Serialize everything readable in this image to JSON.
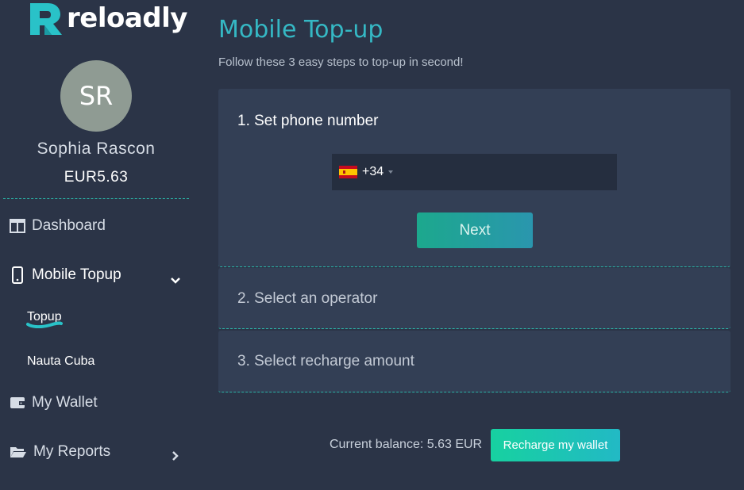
{
  "brand": {
    "name": "reloadly",
    "accent": "#35b8c4"
  },
  "user": {
    "initials": "SR",
    "name": "Sophia Rascon",
    "balance": "EUR5.63"
  },
  "sidebar": {
    "items": [
      {
        "label": "Dashboard",
        "icon": "columns-icon"
      },
      {
        "label": "Mobile Topup",
        "icon": "mobile-phone-icon",
        "expanded": true,
        "children": [
          {
            "label": "Topup",
            "active": true
          },
          {
            "label": "Nauta Cuba"
          }
        ]
      },
      {
        "label": "My Wallet",
        "icon": "wallet-icon"
      },
      {
        "label": "My Reports",
        "icon": "folder-open-icon"
      }
    ]
  },
  "main": {
    "title": "Mobile Top-up",
    "subtitle": "Follow these 3 easy steps to top-up in second!",
    "steps": [
      {
        "label": "1. Set phone number"
      },
      {
        "label": "2. Select an operator"
      },
      {
        "label": "3. Select recharge amount"
      }
    ],
    "phone": {
      "dial_code": "+34",
      "country_flag": "spain-flag-icon",
      "value": ""
    },
    "next_label": "Next",
    "balance_text": "Current balance: 5.63 EUR",
    "recharge_label": "Recharge my wallet"
  }
}
